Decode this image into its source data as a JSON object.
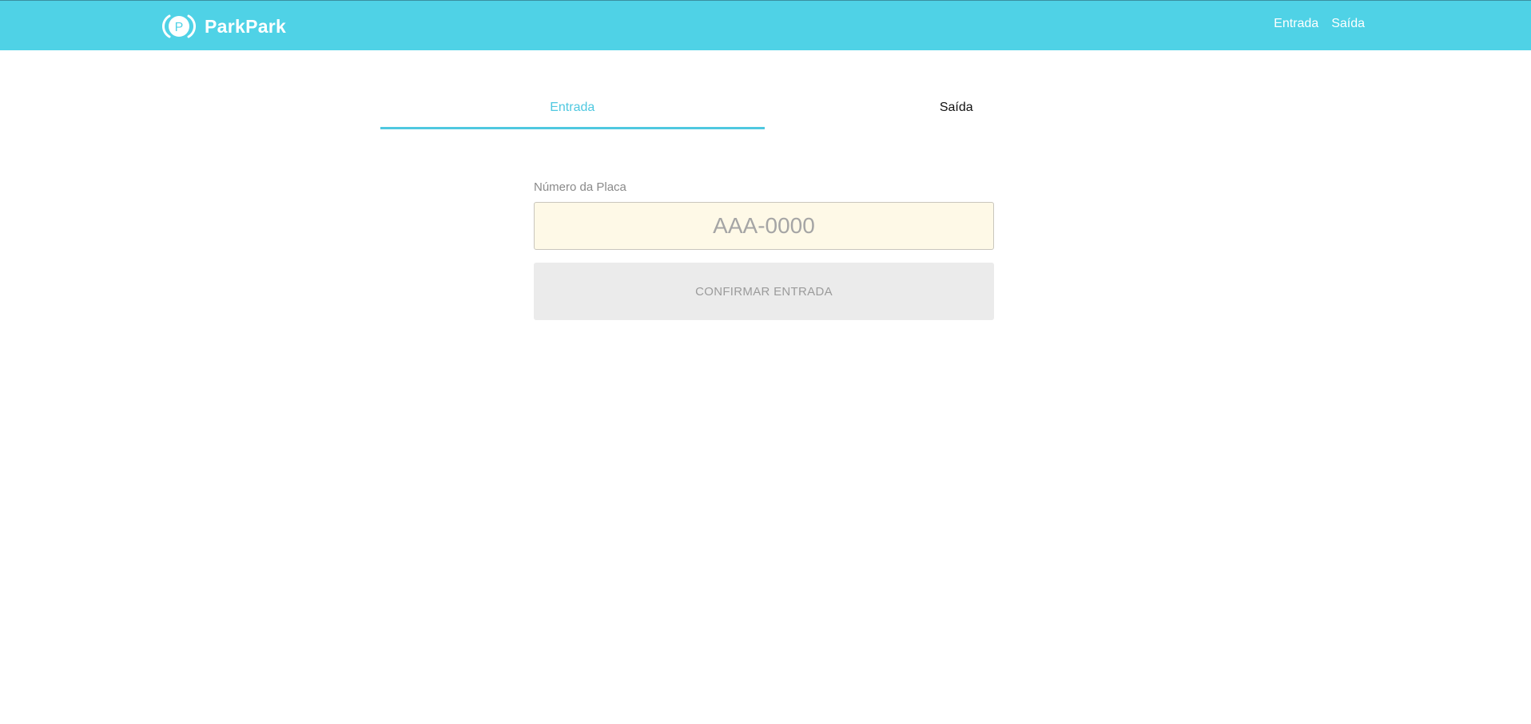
{
  "header": {
    "brand_name": "ParkPark",
    "logo_icon": "parking-p-icon",
    "logo_letter": "P",
    "nav": {
      "entrada": "Entrada",
      "saida": "Saída"
    },
    "background_color": "#4fd2e6"
  },
  "tabs": {
    "items": [
      {
        "label": "Entrada",
        "active": true
      },
      {
        "label": "Saída",
        "active": false
      }
    ],
    "accent_color": "#4fc8e0"
  },
  "form": {
    "plate_label": "Número da Placa",
    "plate_placeholder": "AAA-0000",
    "plate_value": "",
    "confirm_label": "CONFIRMAR ENTRADA",
    "confirm_disabled": true
  }
}
